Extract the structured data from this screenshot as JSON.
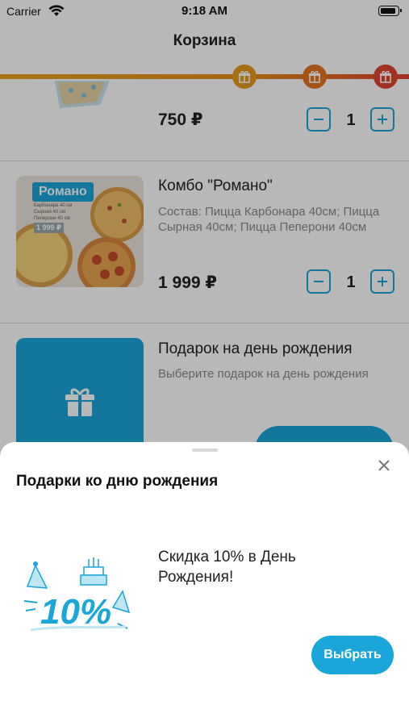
{
  "status_bar": {
    "carrier": "Carrier",
    "time": "9:18 AM"
  },
  "nav": {
    "title": "Корзина"
  },
  "progress": {
    "gift_markers": [
      {
        "icon": "gift-icon",
        "color": "#e59a1e"
      },
      {
        "icon": "gift-icon",
        "color": "#e5741f"
      },
      {
        "icon": "gift-icon",
        "color": "#e0452f"
      }
    ]
  },
  "cart": {
    "items": [
      {
        "price": "750 ₽",
        "quantity": "1"
      },
      {
        "title": "Комбо \"Романо\"",
        "description": "Состав: Пицца Карбонара 40см; Пицца Сырная 40см; Пицца Пеперони 40см",
        "image_tag": "Романо",
        "image_lines": [
          "Карбонара 40 см",
          "Сырная 40 см",
          "Пеперони 40 см"
        ],
        "image_price": "1 999 ₽",
        "price": "1 999 ₽",
        "quantity": "1"
      },
      {
        "title": "Подарок на день рождения",
        "description": "Выберите подарок на день рождения",
        "icon": "gift-icon"
      }
    ]
  },
  "sheet": {
    "title": "Подарки ко дню рождения",
    "gift": {
      "text": "Скидка 10% в День Рождения!",
      "badge": "10%"
    },
    "choose_label": "Выбрать"
  },
  "colors": {
    "accent": "#1aa6d8",
    "progress_start": "#e8a322",
    "progress_end": "#e0452f"
  }
}
